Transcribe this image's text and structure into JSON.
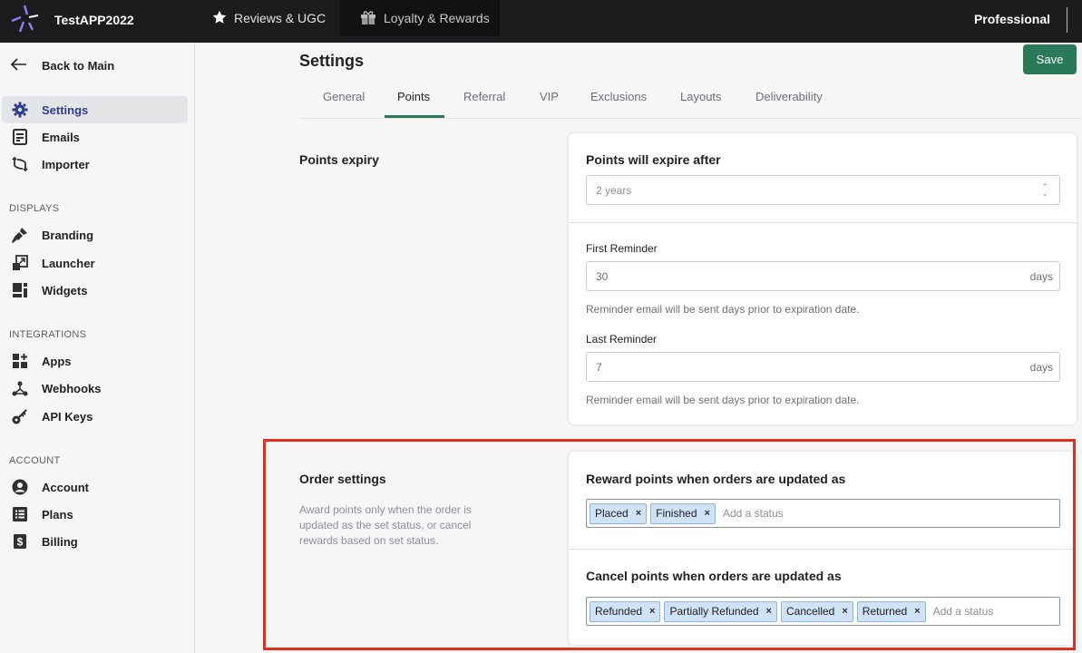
{
  "topbar": {
    "app_name": "TestAPP2022",
    "nav_reviews": "Reviews & UGC",
    "nav_loyalty": "Loyalty & Rewards",
    "plan": "Professional"
  },
  "sidebar": {
    "back": "Back to Main",
    "items_top": [
      {
        "label": "Settings",
        "icon": "gear-icon"
      },
      {
        "label": "Emails",
        "icon": "email-icon"
      },
      {
        "label": "Importer",
        "icon": "importer-icon"
      }
    ],
    "displays_title": "DISPLAYS",
    "displays": [
      {
        "label": "Branding",
        "icon": "paint-icon"
      },
      {
        "label": "Launcher",
        "icon": "launcher-icon"
      },
      {
        "label": "Widgets",
        "icon": "widgets-icon"
      }
    ],
    "integrations_title": "INTEGRATIONS",
    "integrations": [
      {
        "label": "Apps",
        "icon": "apps-icon"
      },
      {
        "label": "Webhooks",
        "icon": "webhook-icon"
      },
      {
        "label": "API Keys",
        "icon": "key-icon"
      }
    ],
    "account_title": "ACCOUNT",
    "account": [
      {
        "label": "Account",
        "icon": "user-icon"
      },
      {
        "label": "Plans",
        "icon": "list-icon"
      },
      {
        "label": "Billing",
        "icon": "dollar-icon"
      }
    ]
  },
  "main": {
    "title": "Settings",
    "save_label": "Save",
    "tabs": [
      "General",
      "Points",
      "Referral",
      "VIP",
      "Exclusions",
      "Layouts",
      "Deliverability"
    ],
    "active_tab": "Points"
  },
  "points_expiry": {
    "section_title": "Points expiry",
    "card_title": "Points will expire after",
    "expire_value": "2 years",
    "first_label": "First Reminder",
    "first_value": "30",
    "first_suffix": "days",
    "first_help": "Reminder email will be sent days prior to expiration date.",
    "last_label": "Last Reminder",
    "last_value": "7",
    "last_suffix": "days",
    "last_help": "Reminder email will be sent days prior to expiration date."
  },
  "order_settings": {
    "section_title": "Order settings",
    "section_desc": "Award points only when the order is updated as the set status, or cancel rewards based on set status.",
    "reward_title": "Reward points when orders are updated as",
    "reward_tags": [
      "Placed",
      "Finished"
    ],
    "reward_placeholder": "Add a status",
    "cancel_title": "Cancel points when orders are updated as",
    "cancel_tags": [
      "Refunded",
      "Partially Refunded",
      "Cancelled",
      "Returned"
    ],
    "cancel_placeholder": "Add a status"
  },
  "colors": {
    "accent": "#2a7a59",
    "active_nav": "#2c3e8c",
    "highlight": "#e0301e",
    "tag_bg": "#cfe2f6"
  }
}
